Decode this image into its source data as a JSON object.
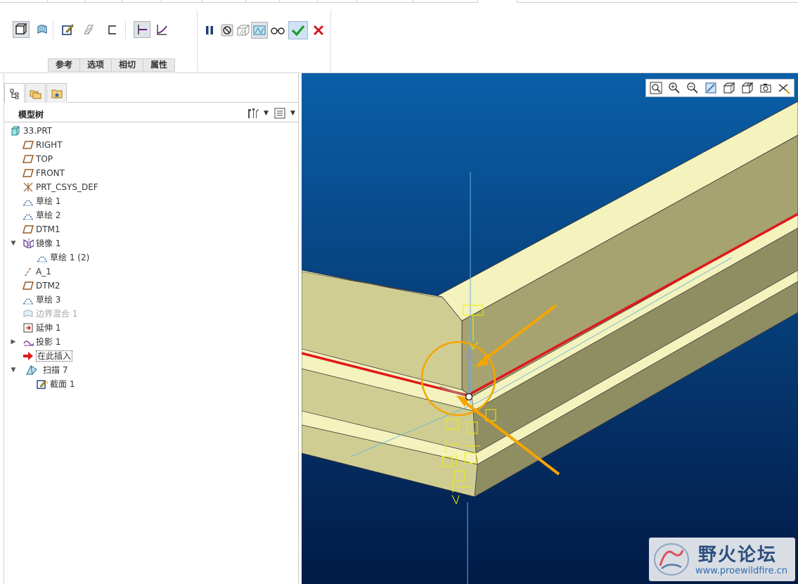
{
  "ribbon": {
    "dashboard_tabs": [
      "参考",
      "选项",
      "相切",
      "属性"
    ]
  },
  "model_tree": {
    "title": "模型树",
    "items": [
      {
        "label": "33.PRT",
        "icon": "part-icon"
      },
      {
        "label": "RIGHT",
        "icon": "datum-plane-icon"
      },
      {
        "label": "TOP",
        "icon": "datum-plane-icon"
      },
      {
        "label": "FRONT",
        "icon": "datum-plane-icon"
      },
      {
        "label": "PRT_CSYS_DEF",
        "icon": "csys-icon"
      },
      {
        "label": "草绘 1",
        "icon": "sketch-icon"
      },
      {
        "label": "草绘 2",
        "icon": "sketch-icon"
      },
      {
        "label": "DTM1",
        "icon": "datum-plane-icon"
      },
      {
        "label": "镜像 1",
        "icon": "mirror-icon",
        "expanded": true
      },
      {
        "label": "草绘 1 (2)",
        "icon": "sketch-icon"
      },
      {
        "label": "A_1",
        "icon": "datum-axis-icon"
      },
      {
        "label": "DTM2",
        "icon": "datum-plane-icon"
      },
      {
        "label": "草绘 3",
        "icon": "sketch-icon"
      },
      {
        "label": "边界混合 1",
        "icon": "boundary-blend-icon",
        "disabled": true
      },
      {
        "label": "延伸 1",
        "icon": "extend-icon"
      },
      {
        "label": "投影 1",
        "icon": "project-icon",
        "collapsed": true
      },
      {
        "label": "在此插入",
        "icon": "insert-here-icon"
      },
      {
        "label": "扫描 7",
        "icon": "sweep-icon",
        "expanded": true
      },
      {
        "label": "截面 1",
        "icon": "section-icon"
      }
    ]
  },
  "watermark": {
    "title": "野火论坛",
    "url": "www.proewildfire.cn"
  },
  "colors": {
    "viewport_top": "#0a5fa8",
    "viewport_bottom": "#021a46",
    "model_light": "#f4f2bd",
    "model_mid": "#cfcd92",
    "model_dark": "#8c8a5e",
    "trajectory": "#e0181a",
    "annotation": "#f5a500",
    "accent": "#1f5f9f"
  }
}
